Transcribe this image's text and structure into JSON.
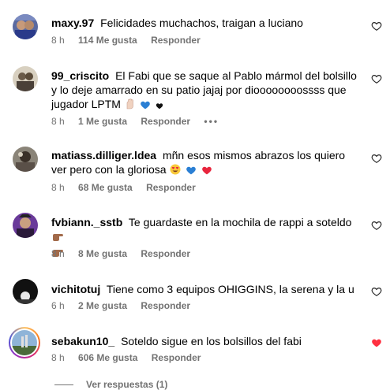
{
  "comments": [
    {
      "user": "maxy.97",
      "text": "Felicidades muchachos, traigan a luciano",
      "time": "8 h",
      "likes": "114 Me gusta",
      "reply": "Responder",
      "liked": false
    },
    {
      "user": "99_criscito",
      "text": "El Fabi que se saque al Pablo mármol del bolsillo y lo deje amarrado en su patio jajaj por dioooooooossss que jugador LPTM",
      "time": "8 h",
      "likes": "1 Me gusta",
      "reply": "Responder",
      "more": "•••",
      "liked": false
    },
    {
      "user": "matiass.dilliger.ldea",
      "text": "mñn esos mismos abrazos los quiero ver pero con la gloriosa",
      "time": "8 h",
      "likes": "68 Me gusta",
      "reply": "Responder",
      "liked": false
    },
    {
      "user": "fvbiann._sstb",
      "text": "Te guardaste en la mochila de rappi a soteldo",
      "time": "8 h",
      "likes": "8 Me gusta",
      "reply": "Responder",
      "liked": false
    },
    {
      "user": "vichitotuj",
      "text": "Tiene como 3 equipos OHIGGINS, la serena y la u",
      "time": "6 h",
      "likes": "2 Me gusta",
      "reply": "Responder",
      "liked": false
    },
    {
      "user": "sebakun10_",
      "text": "Soteldo sigue en los bolsillos del fabi",
      "time": "8 h",
      "likes": "606 Me gusta",
      "reply": "Responder",
      "liked": true
    }
  ],
  "view_replies": "Ver respuestas (1)",
  "colors": {
    "heart_liked": "#ff3040",
    "meta": "#737373"
  }
}
